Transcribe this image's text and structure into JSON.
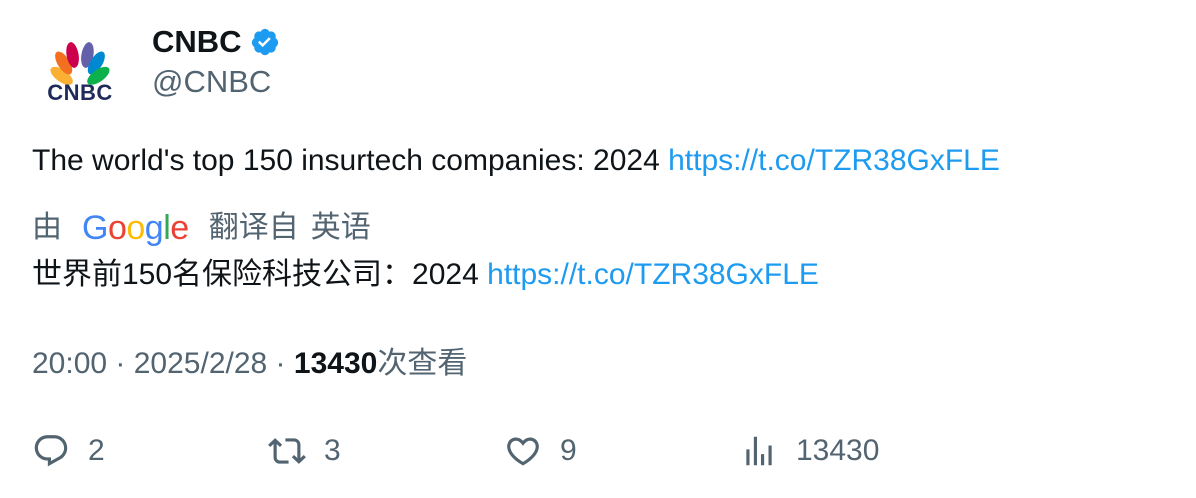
{
  "author": {
    "display_name": "CNBC",
    "handle": "@CNBC",
    "avatar_icon": "cnbc-peacock-logo",
    "avatar_logo_text": "CNBC",
    "verified_icon": "verified-badge-icon",
    "verified_color": "#1d9bf0"
  },
  "tweet": {
    "text": "The world's top 150 insurtech companies: 2024 ",
    "link": "https://t.co/TZR38GxFLE"
  },
  "translation": {
    "prefix": "由",
    "provider_logo": "Google",
    "suffix_1": "翻译自",
    "suffix_2": "英语",
    "text": "世界前150名保险科技公司：2024 ",
    "link": "https://t.co/TZR38GxFLE"
  },
  "meta": {
    "time": "20:00",
    "separator_1": " · ",
    "date": "2025/2/28",
    "separator_2": " · ",
    "views": "13430",
    "views_suffix": "次查看"
  },
  "actions": {
    "reply": {
      "icon": "reply-icon",
      "count": "2"
    },
    "retweet": {
      "icon": "retweet-icon",
      "count": "3"
    },
    "like": {
      "icon": "heart-icon",
      "count": "9"
    },
    "views": {
      "icon": "analytics-icon",
      "count": "13430"
    }
  },
  "colors": {
    "text_primary": "#0f1419",
    "text_secondary": "#536471",
    "link": "#1d9bf0"
  }
}
